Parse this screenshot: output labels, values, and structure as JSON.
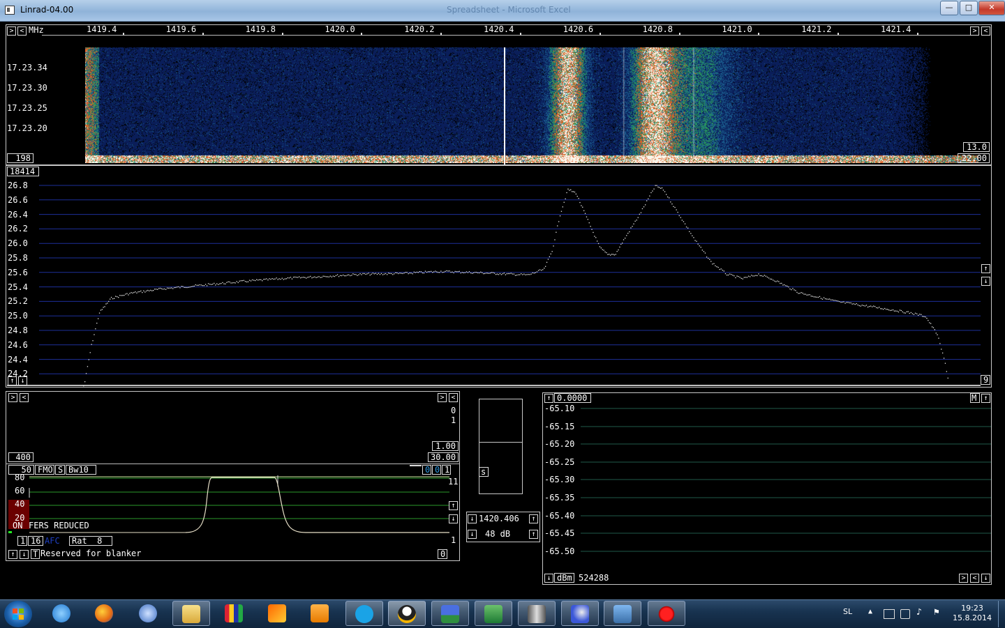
{
  "window": {
    "title": "Linrad-04.00",
    "background_title": "Spreadsheet - Microsoft Excel"
  },
  "waterfall": {
    "freq_axis_label": "MHz",
    "freq_ticks": [
      "1419.4",
      "1419.6",
      "1419.8",
      "1420.0",
      "1420.2",
      "1420.4",
      "1420.6",
      "1420.8",
      "1421.0",
      "1421.2",
      "1421.4"
    ],
    "time_labels": [
      "17.23.34",
      "17.23.30",
      "17.23.25",
      "17.23.20"
    ],
    "left_box": "198",
    "right_box_top": "13.0",
    "right_box_bottom": "22.00"
  },
  "spectrum": {
    "top_left_box": "18414",
    "y_labels": [
      "26.8",
      "26.6",
      "26.4",
      "26.2",
      "26.0",
      "25.8",
      "25.6",
      "25.4",
      "25.2",
      "25.0",
      "24.8",
      "24.6",
      "24.4",
      "24.2"
    ],
    "right_box": "9",
    "ylim": [
      24.2,
      26.8
    ],
    "xlim": [
      1419.25,
      1421.6
    ],
    "points": [
      [
        1419.3,
        24.0
      ],
      [
        1419.32,
        24.6
      ],
      [
        1419.34,
        25.05
      ],
      [
        1419.37,
        25.25
      ],
      [
        1419.42,
        25.32
      ],
      [
        1419.5,
        25.38
      ],
      [
        1419.6,
        25.43
      ],
      [
        1419.7,
        25.48
      ],
      [
        1419.8,
        25.52
      ],
      [
        1419.9,
        25.55
      ],
      [
        1420.0,
        25.58
      ],
      [
        1420.1,
        25.59
      ],
      [
        1420.2,
        25.62
      ],
      [
        1420.3,
        25.6
      ],
      [
        1420.38,
        25.58
      ],
      [
        1420.42,
        25.57
      ],
      [
        1420.46,
        25.65
      ],
      [
        1420.48,
        25.9
      ],
      [
        1420.5,
        26.4
      ],
      [
        1420.52,
        26.75
      ],
      [
        1420.54,
        26.7
      ],
      [
        1420.56,
        26.45
      ],
      [
        1420.58,
        26.2
      ],
      [
        1420.6,
        25.95
      ],
      [
        1420.62,
        25.85
      ],
      [
        1420.64,
        25.86
      ],
      [
        1420.66,
        26.05
      ],
      [
        1420.7,
        26.4
      ],
      [
        1420.74,
        26.8
      ],
      [
        1420.76,
        26.75
      ],
      [
        1420.8,
        26.4
      ],
      [
        1420.84,
        26.05
      ],
      [
        1420.88,
        25.75
      ],
      [
        1420.92,
        25.58
      ],
      [
        1420.96,
        25.52
      ],
      [
        1421.0,
        25.58
      ],
      [
        1421.04,
        25.5
      ],
      [
        1421.1,
        25.33
      ],
      [
        1421.2,
        25.2
      ],
      [
        1421.3,
        25.12
      ],
      [
        1421.38,
        25.05
      ],
      [
        1421.42,
        25.0
      ],
      [
        1421.45,
        24.75
      ],
      [
        1421.47,
        24.35
      ],
      [
        1421.48,
        24.05
      ]
    ]
  },
  "baseband": {
    "side_values": [
      "0",
      "1"
    ],
    "box_1": "1.00",
    "box_2": "30.00",
    "box_3": "400",
    "ctrl_50": "50",
    "ctrl_fmo": "FMO",
    "ctrl_s": "S",
    "ctrl_bw": "Bw10",
    "ctrl_r1": "0",
    "ctrl_r2": "0",
    "ctrl_r3": "1",
    "graph_y": [
      "80",
      "60",
      "40",
      "20"
    ],
    "right_11": "11",
    "right_1": "1",
    "on_label": "ON",
    "fers_label": "FERS REDUCED",
    "small_1": "1",
    "small_16": "16",
    "afc_label": "AFC",
    "rat_label": "Rat  8",
    "t_label": "T",
    "blanker": "Reserved for blanker",
    "blanker_val": "0"
  },
  "smeter": {
    "s_label": "s",
    "freq": "1420.406",
    "gain": "48 dB"
  },
  "level": {
    "top_box": "0.0000",
    "m_label": "M",
    "y_labels": [
      "-65.10",
      "-65.15",
      "-65.20",
      "-65.25",
      "-65.30",
      "-65.35",
      "-65.40",
      "-65.45",
      "-65.50"
    ],
    "unit": "dBm",
    "count": "524288"
  },
  "taskbar": {
    "language": "SL",
    "time": "19:23",
    "date": "15.8.2014"
  }
}
